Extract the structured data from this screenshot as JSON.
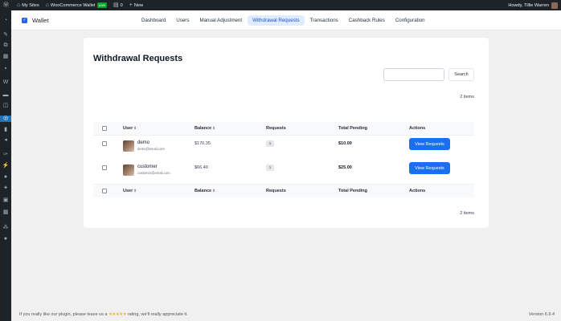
{
  "adminbar": {
    "my_sites": "My Sites",
    "site_name": "WooCommerce Wallet",
    "live": "Live",
    "comments_count": "0",
    "new_label": "New",
    "greeting": "Howdy, Tillie Warren"
  },
  "brand": {
    "title": "Wallet"
  },
  "nav": {
    "items": [
      {
        "label": "Dashboard"
      },
      {
        "label": "Users"
      },
      {
        "label": "Manual Adjustment"
      },
      {
        "label": "Withdrawal Requests"
      },
      {
        "label": "Transactions"
      },
      {
        "label": "Cashback Rules"
      },
      {
        "label": "Configuration"
      }
    ],
    "active_index": 3
  },
  "page": {
    "title": "Withdrawal Requests",
    "search_button": "Search",
    "search_value": "",
    "items_count_top": "2 items",
    "items_count_bottom": "2 items"
  },
  "table": {
    "columns": {
      "user": "User",
      "balance": "Balance",
      "requests": "Requests",
      "total_pending": "Total Pending",
      "actions": "Actions"
    },
    "rows": [
      {
        "name": "demo",
        "email": "demo@email.com",
        "balance": "$170.35",
        "requests": "1",
        "total_pending": "$10.00",
        "action": "View Requests"
      },
      {
        "name": "customer",
        "email": "customer@email.com",
        "balance": "$66.40",
        "requests": "1",
        "total_pending": "$25.00",
        "action": "View Requests"
      }
    ]
  },
  "footer": {
    "text_before": "If you really like our plugin, please leave us a",
    "stars": "★★★★★",
    "text_after": "rating, we'll really appreciate it.",
    "version": "Version 6.9.4"
  },
  "colors": {
    "accent": "#2563eb",
    "button": "#1a6ff0",
    "admin_bg": "#1d2327",
    "live_green": "#00a32a"
  }
}
